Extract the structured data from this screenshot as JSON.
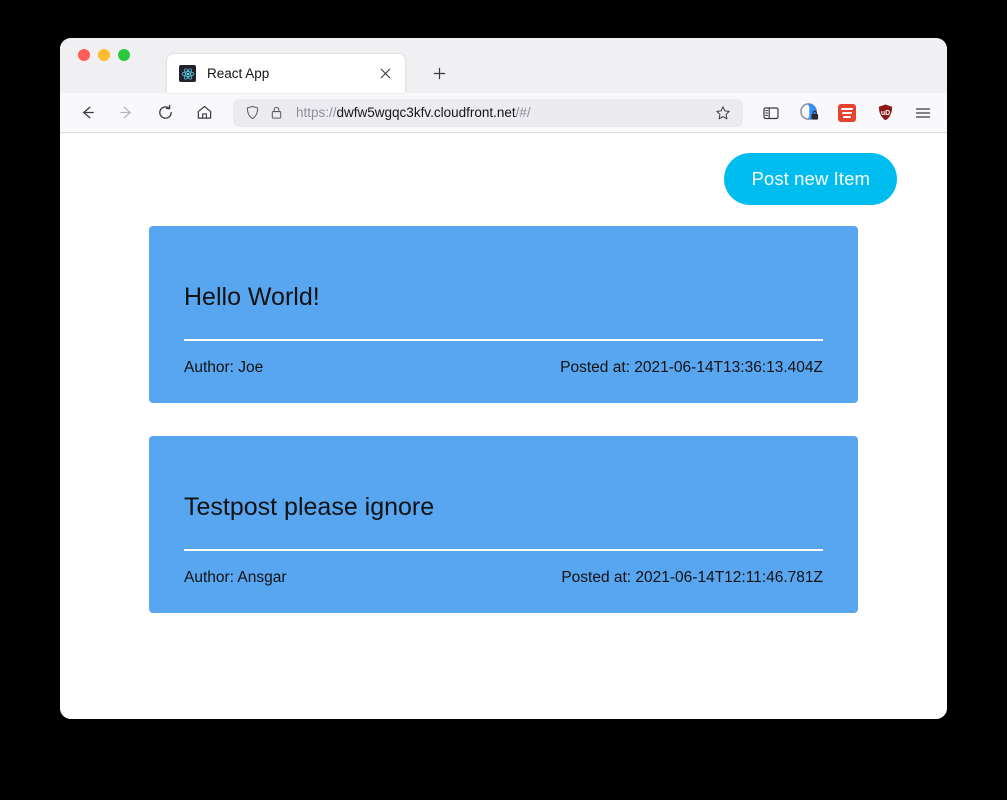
{
  "browser": {
    "traffic_lights": [
      "close",
      "minimize",
      "maximize"
    ],
    "tab": {
      "title": "React App",
      "favicon": "react-logo-icon",
      "close_label": "×"
    },
    "new_tab_label": "+",
    "nav": {
      "back_icon": "back-arrow-icon",
      "forward_icon": "forward-arrow-icon",
      "reload_icon": "reload-icon",
      "home_icon": "home-icon"
    },
    "url_bar": {
      "shield_icon": "shield-icon",
      "lock_icon": "padlock-icon",
      "scheme": "https://",
      "host": "dwfw5wgqc3kfv.cloudfront.net",
      "path": "/#/",
      "full_url": "https://dwfw5wgqc3kfv.cloudfront.net/#/",
      "bookmark_icon": "star-icon"
    },
    "toolbar_icons": [
      {
        "name": "sidebar-icon",
        "label": "Sidebars"
      },
      {
        "name": "privacy-shield-lock-icon",
        "label": "Privacy protections"
      },
      {
        "name": "todoist-icon",
        "label": "Todoist"
      },
      {
        "name": "ublock-origin-icon",
        "label": "uBlock Origin"
      },
      {
        "name": "hamburger-menu-icon",
        "label": "Open application menu"
      }
    ]
  },
  "app": {
    "post_new_button": "Post new Item",
    "posts": [
      {
        "title": "Hello World!",
        "author": "Author: Joe",
        "posted": "Posted at: 2021-06-14T13:36:13.404Z"
      },
      {
        "title": "Testpost please ignore",
        "author": "Author: Ansgar",
        "posted": "Posted at: 2021-06-14T12:11:46.781Z"
      }
    ]
  },
  "colors": {
    "card_blue": "#58A5F0",
    "button_cyan": "#00BDF0",
    "page_background": "#ffffff",
    "desktop_background": "#000000"
  }
}
